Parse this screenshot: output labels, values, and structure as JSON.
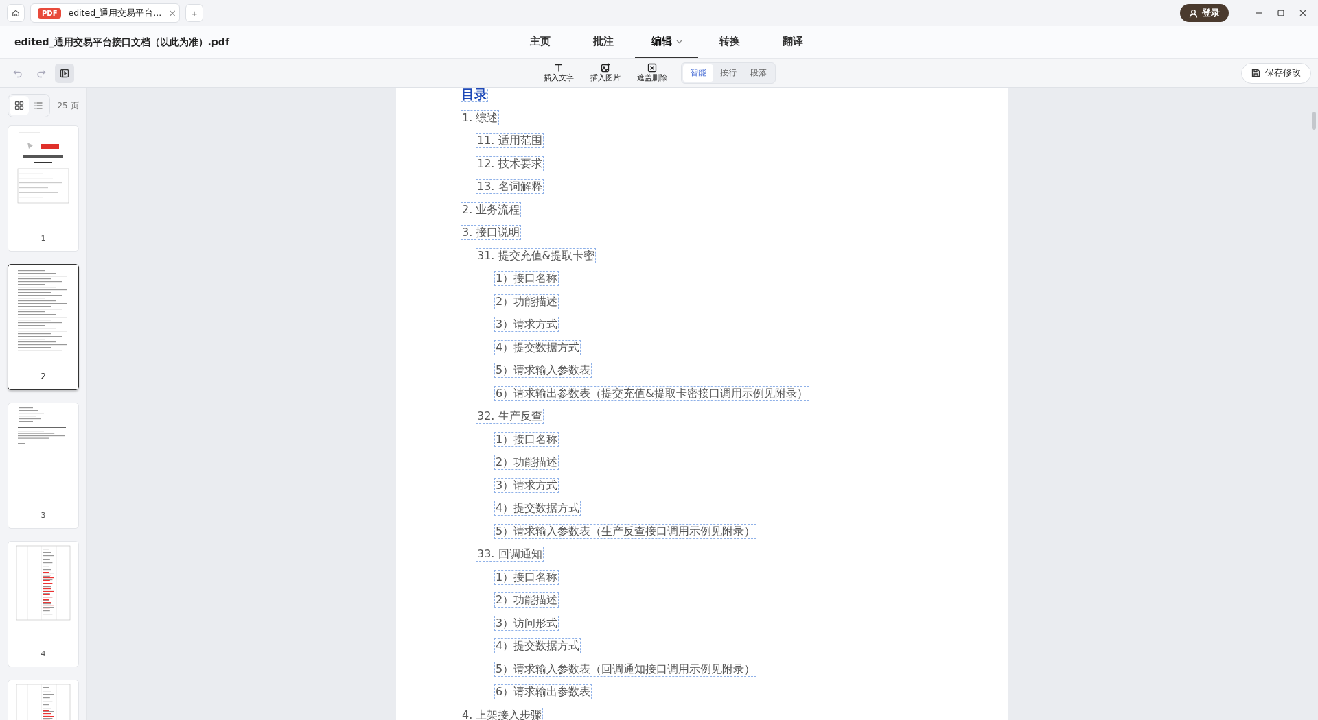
{
  "tab_bar": {
    "tabs": [
      {
        "badge": "PDF",
        "title": "edited_通用交易平台...",
        "close": "×",
        "selected": true
      }
    ],
    "new_tab": "+",
    "login": "登录"
  },
  "document_title": "edited_通用交易平台接口文档（以此为准）.pdf",
  "ribbon_tabs": [
    {
      "label": "主页",
      "selected": false
    },
    {
      "label": "批注",
      "selected": false
    },
    {
      "label": "编辑",
      "selected": true,
      "dropdown": true
    },
    {
      "label": "转换",
      "selected": false
    },
    {
      "label": "翻译",
      "selected": false
    }
  ],
  "toolbar": {
    "tools": [
      {
        "label": "插入文字",
        "kind": "text"
      },
      {
        "label": "插入图片",
        "kind": "image"
      },
      {
        "label": "遮盖删除",
        "kind": "mask"
      }
    ],
    "modes": [
      {
        "label": "智能",
        "selected": true
      },
      {
        "label": "按行",
        "selected": false
      },
      {
        "label": "段落",
        "selected": false
      }
    ],
    "save": "保存修改"
  },
  "sidebar": {
    "views": [
      {
        "kind": "grid",
        "selected": true
      },
      {
        "kind": "list",
        "selected": false
      }
    ],
    "page_count": "25 页",
    "pages": [
      {
        "number": "1",
        "kind": "cover",
        "selected": false
      },
      {
        "number": "2",
        "kind": "toc",
        "selected": true
      },
      {
        "number": "3",
        "kind": "text",
        "selected": false
      },
      {
        "number": "4",
        "kind": "table",
        "selected": false
      },
      {
        "kind": "table",
        "selected": false
      }
    ]
  },
  "toc": {
    "heading": "目录",
    "items": [
      {
        "text": "1. 综述",
        "children": [
          {
            "text": "11. 适用范围"
          },
          {
            "text": "12. 技术要求"
          },
          {
            "text": "13. 名词解释"
          }
        ]
      },
      {
        "text": "2. 业务流程"
      },
      {
        "text": "3. 接口说明",
        "children": [
          {
            "text": "31. 提交充值&提取卡密",
            "children": [
              {
                "text": "1）接口名称"
              },
              {
                "text": "2）功能描述"
              },
              {
                "text": "3）请求方式"
              },
              {
                "text": "4）提交数据方式"
              },
              {
                "text": "5）请求输入参数表"
              },
              {
                "text": "6）请求输出参数表（提交充值&提取卡密接口调用示例见附录）"
              }
            ]
          },
          {
            "text": "32. 生产反查",
            "children": [
              {
                "text": "1）接口名称"
              },
              {
                "text": "2）功能描述"
              },
              {
                "text": "3）请求方式"
              },
              {
                "text": "4）提交数据方式"
              },
              {
                "text": "5）请求输入参数表（生产反查接口调用示例见附录）"
              }
            ]
          },
          {
            "text": "33. 回调通知",
            "children": [
              {
                "text": "1）接口名称"
              },
              {
                "text": "2）功能描述"
              },
              {
                "text": "3）访问形式"
              },
              {
                "text": "4）提交数据方式"
              },
              {
                "text": "5）请求输入参数表（回调通知接口调用示例见附录）"
              },
              {
                "text": "6）请求输出参数表"
              }
            ]
          }
        ]
      },
      {
        "text": "4. 上架接入步骤"
      }
    ]
  }
}
